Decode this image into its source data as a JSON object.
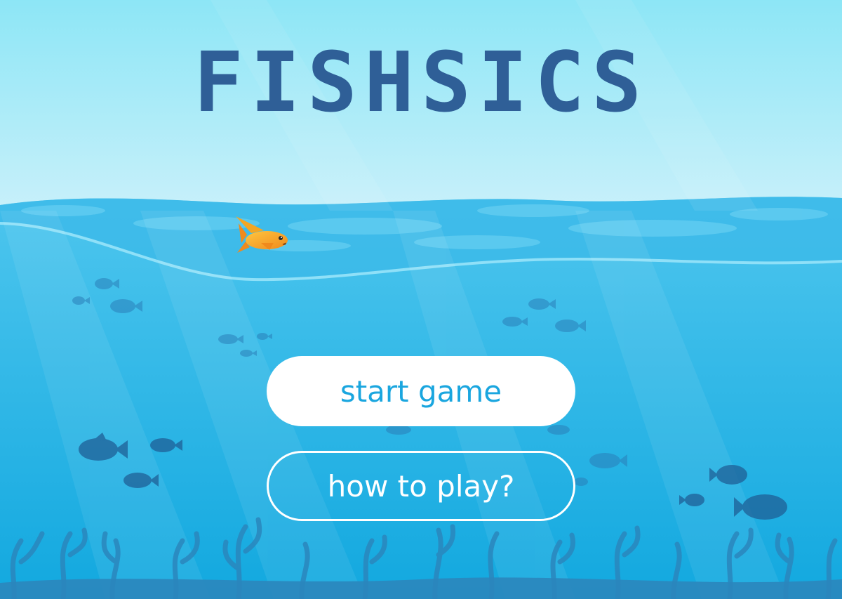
{
  "title": "FISHSICS",
  "buttons": {
    "start_label": "start game",
    "help_label": "how to play?"
  },
  "colors": {
    "sky_top": "#8de6f6",
    "sky_bottom": "#c8f0fa",
    "water_top": "#4ec6ee",
    "water_deep": "#12a8df",
    "title": "#2f5f97",
    "fish_silhouette": "#2a7fb8",
    "coral": "#2b86bd",
    "player_fish": "#f5a623",
    "button_text": "#1aa6df"
  }
}
